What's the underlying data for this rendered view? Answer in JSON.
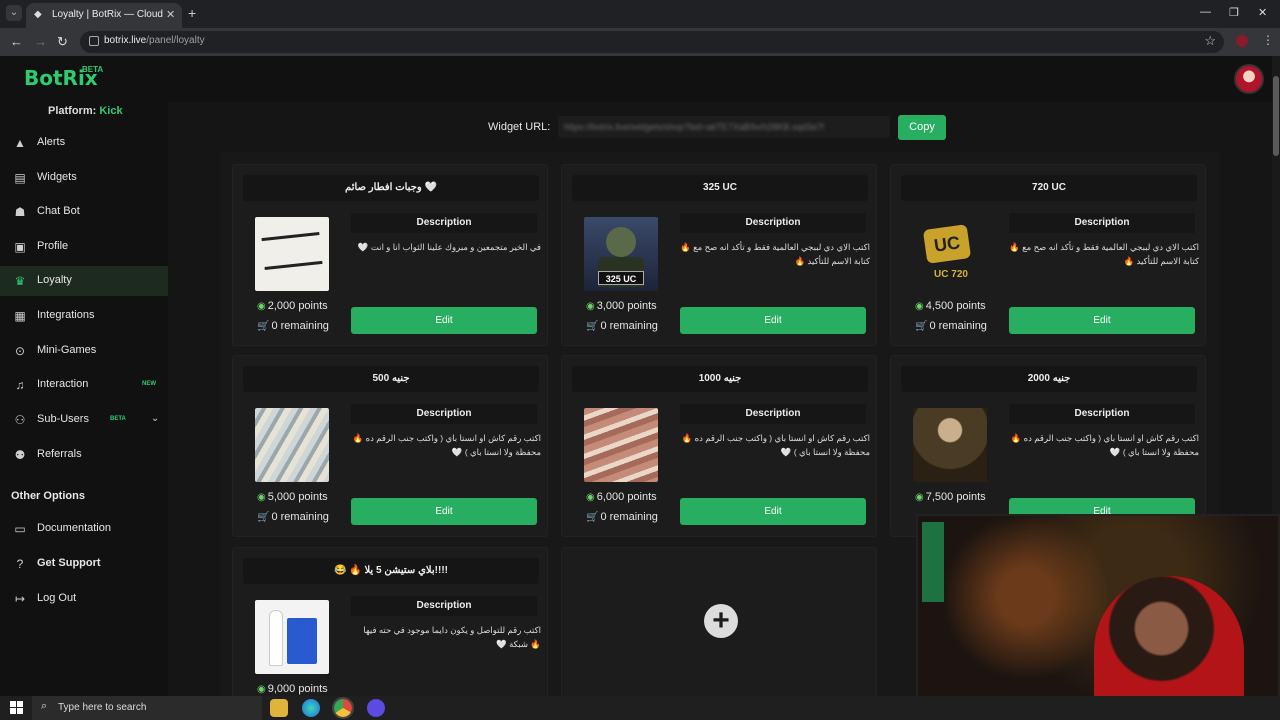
{
  "browser": {
    "tab_title": "Loyalty | BotRix — Cloud Streaming Bot",
    "url_host": "botrix.live",
    "url_path": "/panel/loyalty"
  },
  "app": {
    "logo": "BotRix",
    "beta": "BETA"
  },
  "sidebar": {
    "platform_label": "Platform:",
    "platform_value": "Kick",
    "items": [
      {
        "label": "Alerts",
        "icon": "warning-icon"
      },
      {
        "label": "Widgets",
        "icon": "widgets-icon"
      },
      {
        "label": "Chat Bot",
        "icon": "robot-icon"
      },
      {
        "label": "Profile",
        "icon": "profile-icon"
      },
      {
        "label": "Loyalty",
        "icon": "trophy-icon",
        "active": true
      },
      {
        "label": "Integrations",
        "icon": "integrations-icon"
      },
      {
        "label": "Mini-Games",
        "icon": "gamepad-icon"
      },
      {
        "label": "Interaction",
        "icon": "music-icon",
        "badge": "NEW"
      },
      {
        "label": "Sub-Users",
        "icon": "users-icon",
        "badge": "BETA"
      },
      {
        "label": "Referrals",
        "icon": "referrals-icon"
      }
    ],
    "other_title": "Other Options",
    "other_items": [
      {
        "label": "Documentation",
        "icon": "document-icon"
      },
      {
        "label": "Get Support",
        "icon": "help-icon"
      },
      {
        "label": "Log Out",
        "icon": "logout-icon"
      }
    ]
  },
  "widget": {
    "label": "Widget URL:",
    "value": "https://botrix.live/widgets/shop?bid=abTE7XaB9xrh28KB.sqd3a7f",
    "copy_label": "Copy"
  },
  "rewards": [
    {
      "title": "وجبات افطار صائم 🤍",
      "desc_head": "Description",
      "desc": "في الخير متجمعين و مبروك علينا الثواب انا و انت 🤍",
      "points": "2,000 points",
      "remaining": "0 remaining",
      "edit": "Edit",
      "image": "iftar-image"
    },
    {
      "title": "325 UC",
      "desc_head": "Description",
      "desc": "اكتب الاي دي لببجي العالمية فقط و تأكد انه صح مع 🔥 كتابة الاسم للتأكيد 🔥",
      "points": "3,000 points",
      "remaining": "0 remaining",
      "edit": "Edit",
      "image": "uc325-image"
    },
    {
      "title": "720 UC",
      "desc_head": "Description",
      "desc": "اكتب الاي دي لببجي العالمية فقط و تأكد انه صح مع 🔥 كتابة الاسم للتأكيد 🔥",
      "points": "4,500 points",
      "remaining": "0 remaining",
      "edit": "Edit",
      "image": "uc720-image"
    },
    {
      "title": "500 جنيه",
      "desc_head": "Description",
      "desc": "اكتب رقم كاش او انستا باي ( واكتب جنب الرقم ده 🔥 محفظة ولا انستا باي ) 🤍",
      "points": "5,000 points",
      "remaining": "0 remaining",
      "edit": "Edit",
      "image": "money-image"
    },
    {
      "title": "1000 جنيه",
      "desc_head": "Description",
      "desc": "اكتب رقم كاش او انستا باي ( واكتب جنب الرقم ده 🔥 محفظة ولا انستا باي ) 🤍",
      "points": "6,000 points",
      "remaining": "0 remaining",
      "edit": "Edit",
      "image": "money2-image"
    },
    {
      "title": "2000 جنيه",
      "desc_head": "Description",
      "desc": "اكتب رقم كاش او انستا باي ( واكتب جنب الرقم ده 🔥 محفظة ولا انستا باي ) 🤍",
      "points": "7,500 points",
      "remaining": "",
      "edit": "Edit",
      "image": "painting-image"
    },
    {
      "title": "😂 🔥 بلاي ستيشن 5 يلا!!!!",
      "desc_head": "Description",
      "desc": "اكتب رقم للتواصل و يكون دايما موجود في حته فيها 🔥 شبكة 🤍",
      "points": "9,000 points",
      "remaining": "",
      "edit": "",
      "image": "ps5-image"
    }
  ],
  "taskbar": {
    "search_placeholder": "Type here to search"
  }
}
